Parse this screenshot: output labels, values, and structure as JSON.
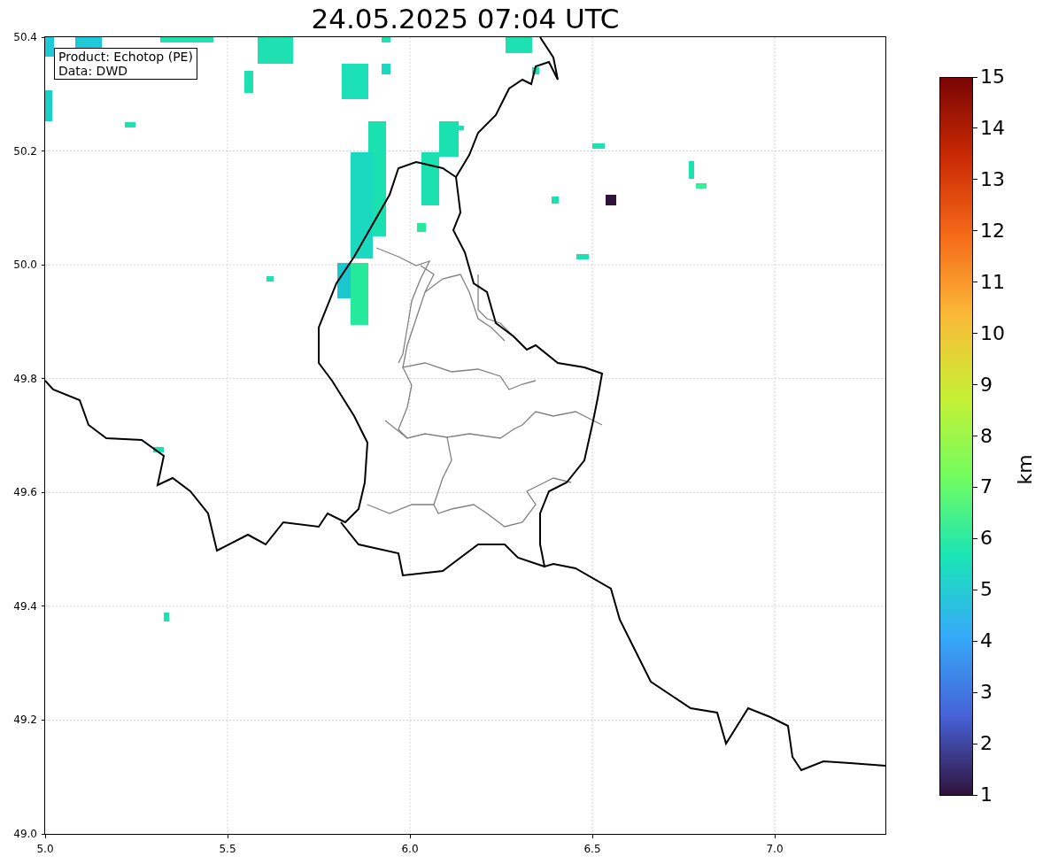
{
  "title": "24.05.2025 07:04 UTC",
  "annotation": [
    "Product: Echotop (PE)",
    "Data: DWD"
  ],
  "y_ticks": [
    "50.4",
    "50.2",
    "50.0",
    "49.8",
    "49.6",
    "49.4",
    "49.2",
    "49.0"
  ],
  "x_ticks": [
    "5.0",
    "5.5",
    "6.0",
    "6.5",
    "7.0"
  ],
  "colorbar": {
    "label": "km",
    "ticks": [
      "15",
      "14",
      "13",
      "12",
      "11",
      "10",
      "9",
      "8",
      "7",
      "6",
      "5",
      "4",
      "3",
      "2",
      "1"
    ]
  }
}
